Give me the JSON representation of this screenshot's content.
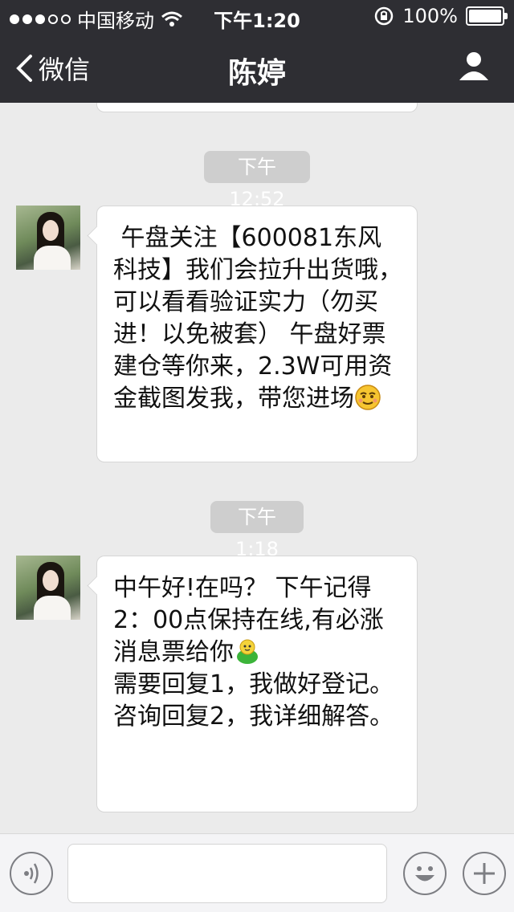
{
  "status_bar": {
    "signal_dots_filled": 3,
    "signal_dots_total": 5,
    "carrier": "中国移动",
    "time": "下午1:20",
    "battery": "100%"
  },
  "nav": {
    "back_label": "微信",
    "title": "陈婷"
  },
  "messages": [
    {
      "timestamp": "下午12:52",
      "text": " 午盘关注【600081东风科技】我们会拉升出货哦，可以看看验证实力（勿买进！以免被套） 午盘好票建仓等你来，2.3W可用资金截图发我，带您进场",
      "emoji": "smirk-emoji"
    },
    {
      "timestamp": "下午1:18",
      "line1": "中午好!在吗？ 下午记得2：00点保持在线,有必涨消息票给你",
      "line2": "需要回复1，我做好登记。\n咨询回复2，我详细解答。",
      "emoji": "frog-emoji"
    }
  ],
  "input": {
    "value": ""
  },
  "colors": {
    "header_bg": "#2e2e33",
    "chat_bg": "#ebebeb",
    "timestamp_bg": "#cecece",
    "bubble_bg": "#ffffff"
  }
}
